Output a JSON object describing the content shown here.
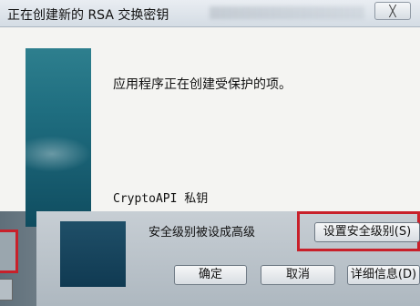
{
  "window": {
    "title": "正在创建新的 RSA 交换密钥",
    "close_glyph": "╳"
  },
  "body": {
    "message": "应用程序正在创建受保护的项。",
    "crypto_label": "CryptoAPI 私钥",
    "security_text": "安全级别被设成高级"
  },
  "buttons": {
    "set_security": "设置安全级别(S)",
    "ok": "确定",
    "cancel": "取消",
    "details": "详细信息(D)"
  }
}
